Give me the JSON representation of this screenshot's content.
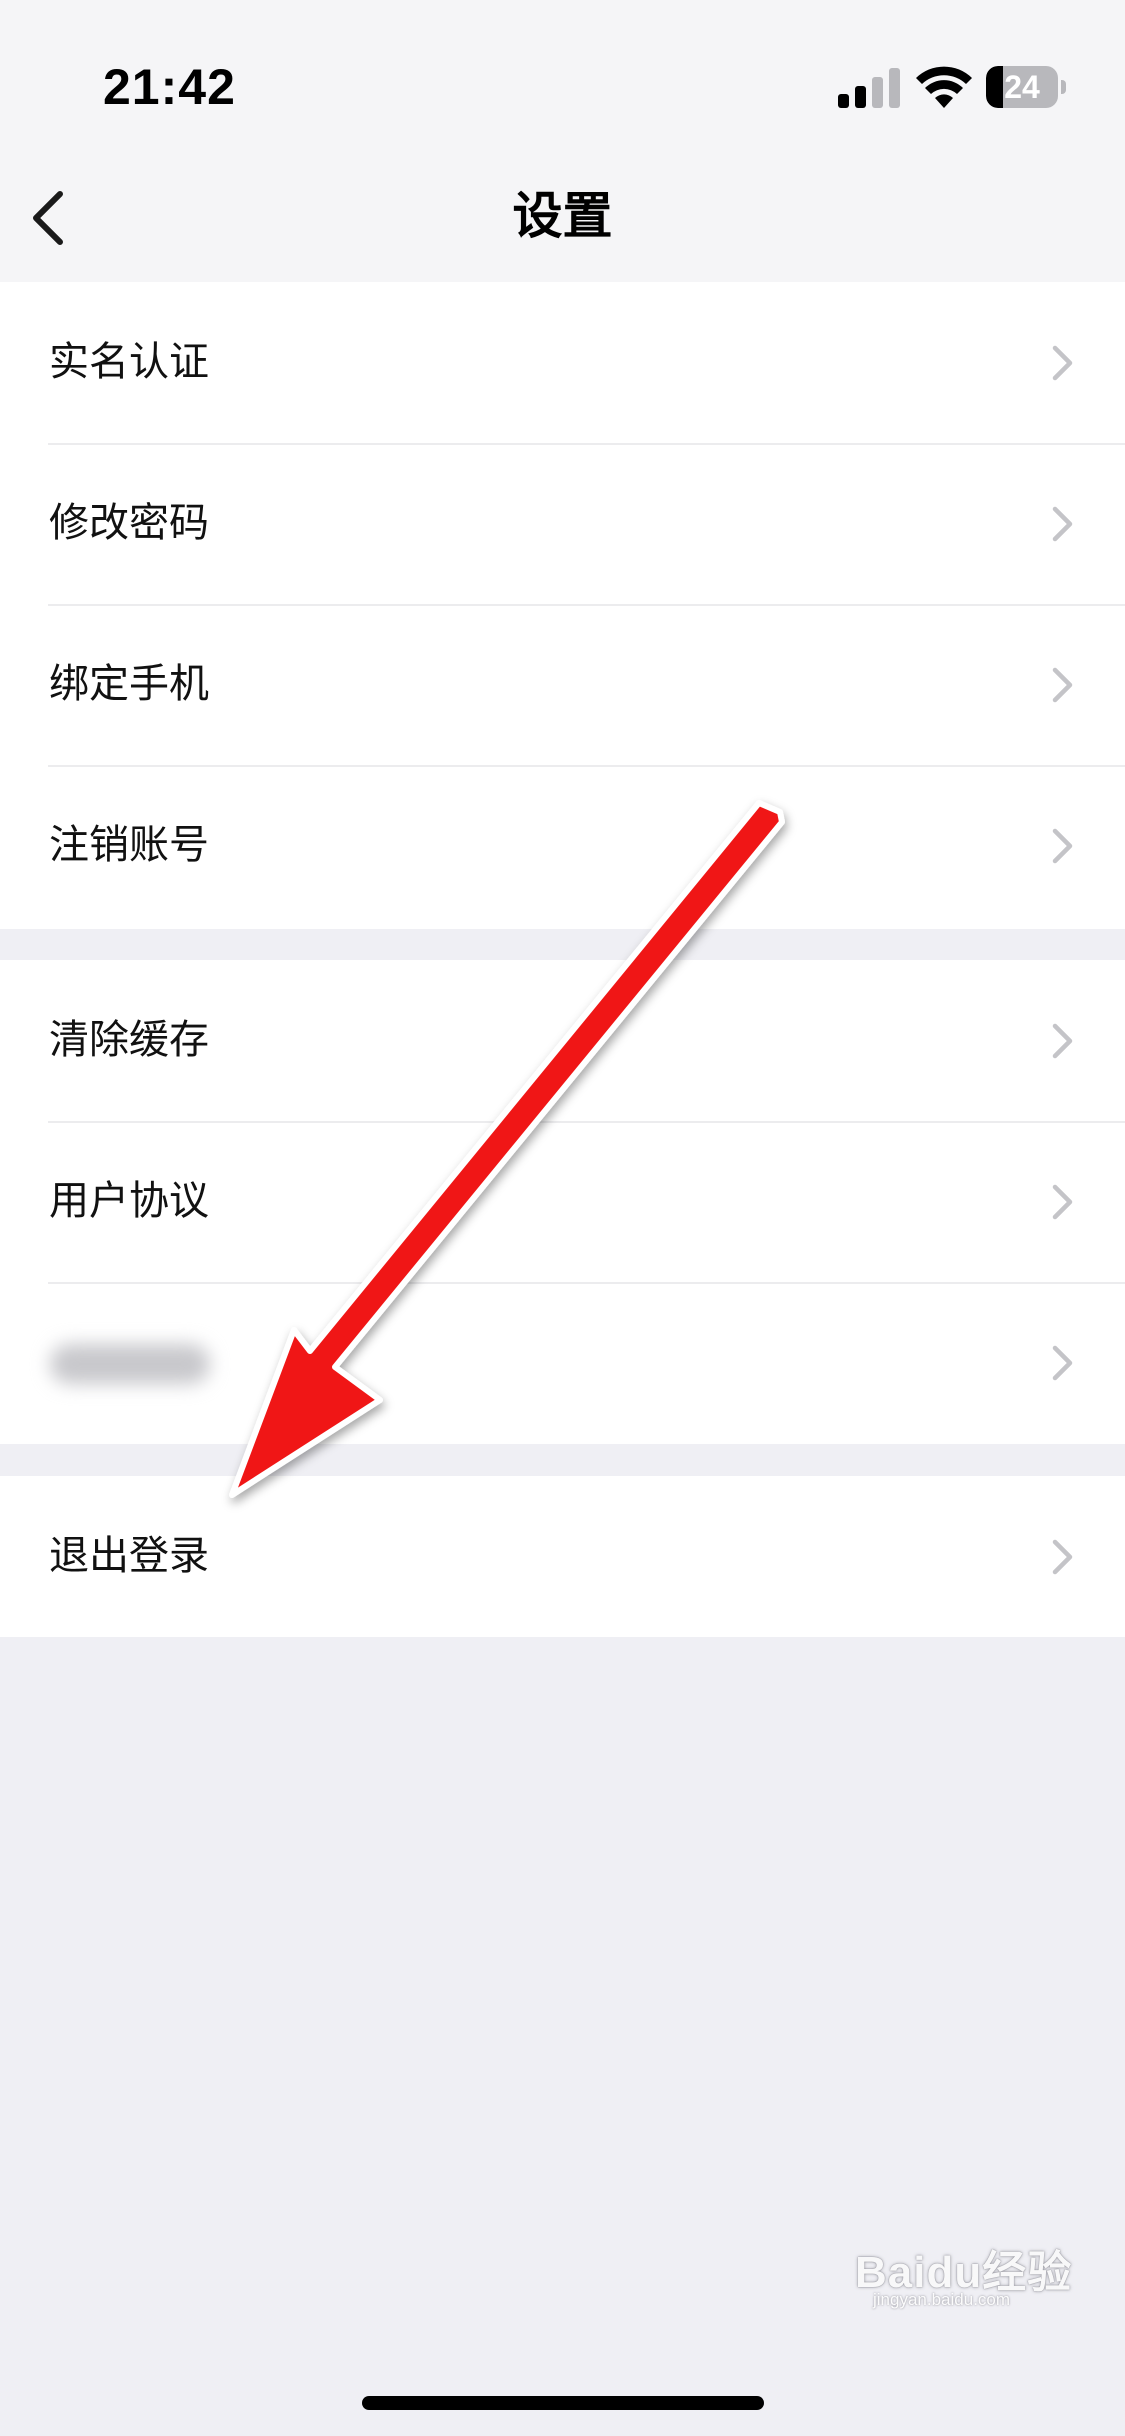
{
  "status_bar": {
    "time": "21:42",
    "battery_level": "24",
    "battery_fraction": 0.24
  },
  "nav": {
    "title": "设置",
    "back_icon": "chevron-left-icon"
  },
  "groups": [
    {
      "items": [
        {
          "label": "实名认证",
          "icon": "chevron-right-icon"
        },
        {
          "label": "修改密码",
          "icon": "chevron-right-icon"
        },
        {
          "label": "绑定手机",
          "icon": "chevron-right-icon"
        },
        {
          "label": "注销账号",
          "icon": "chevron-right-icon"
        }
      ]
    },
    {
      "items": [
        {
          "label": "清除缓存",
          "icon": "chevron-right-icon"
        },
        {
          "label": "用户协议",
          "icon": "chevron-right-icon"
        },
        {
          "label": "",
          "blurred": true,
          "icon": "chevron-right-icon"
        }
      ]
    },
    {
      "items": [
        {
          "label": "退出登录",
          "icon": "chevron-right-icon"
        }
      ]
    }
  ],
  "watermark": {
    "logo": "Baidu经验",
    "url": "jingyan.baidu.com"
  },
  "colors": {
    "background": "#efeff4",
    "bar_background": "#f5f5f7",
    "row_background": "#ffffff",
    "separator": "#ececee",
    "chevron": "#c4c4c8",
    "annotation_arrow": "#f01818"
  }
}
